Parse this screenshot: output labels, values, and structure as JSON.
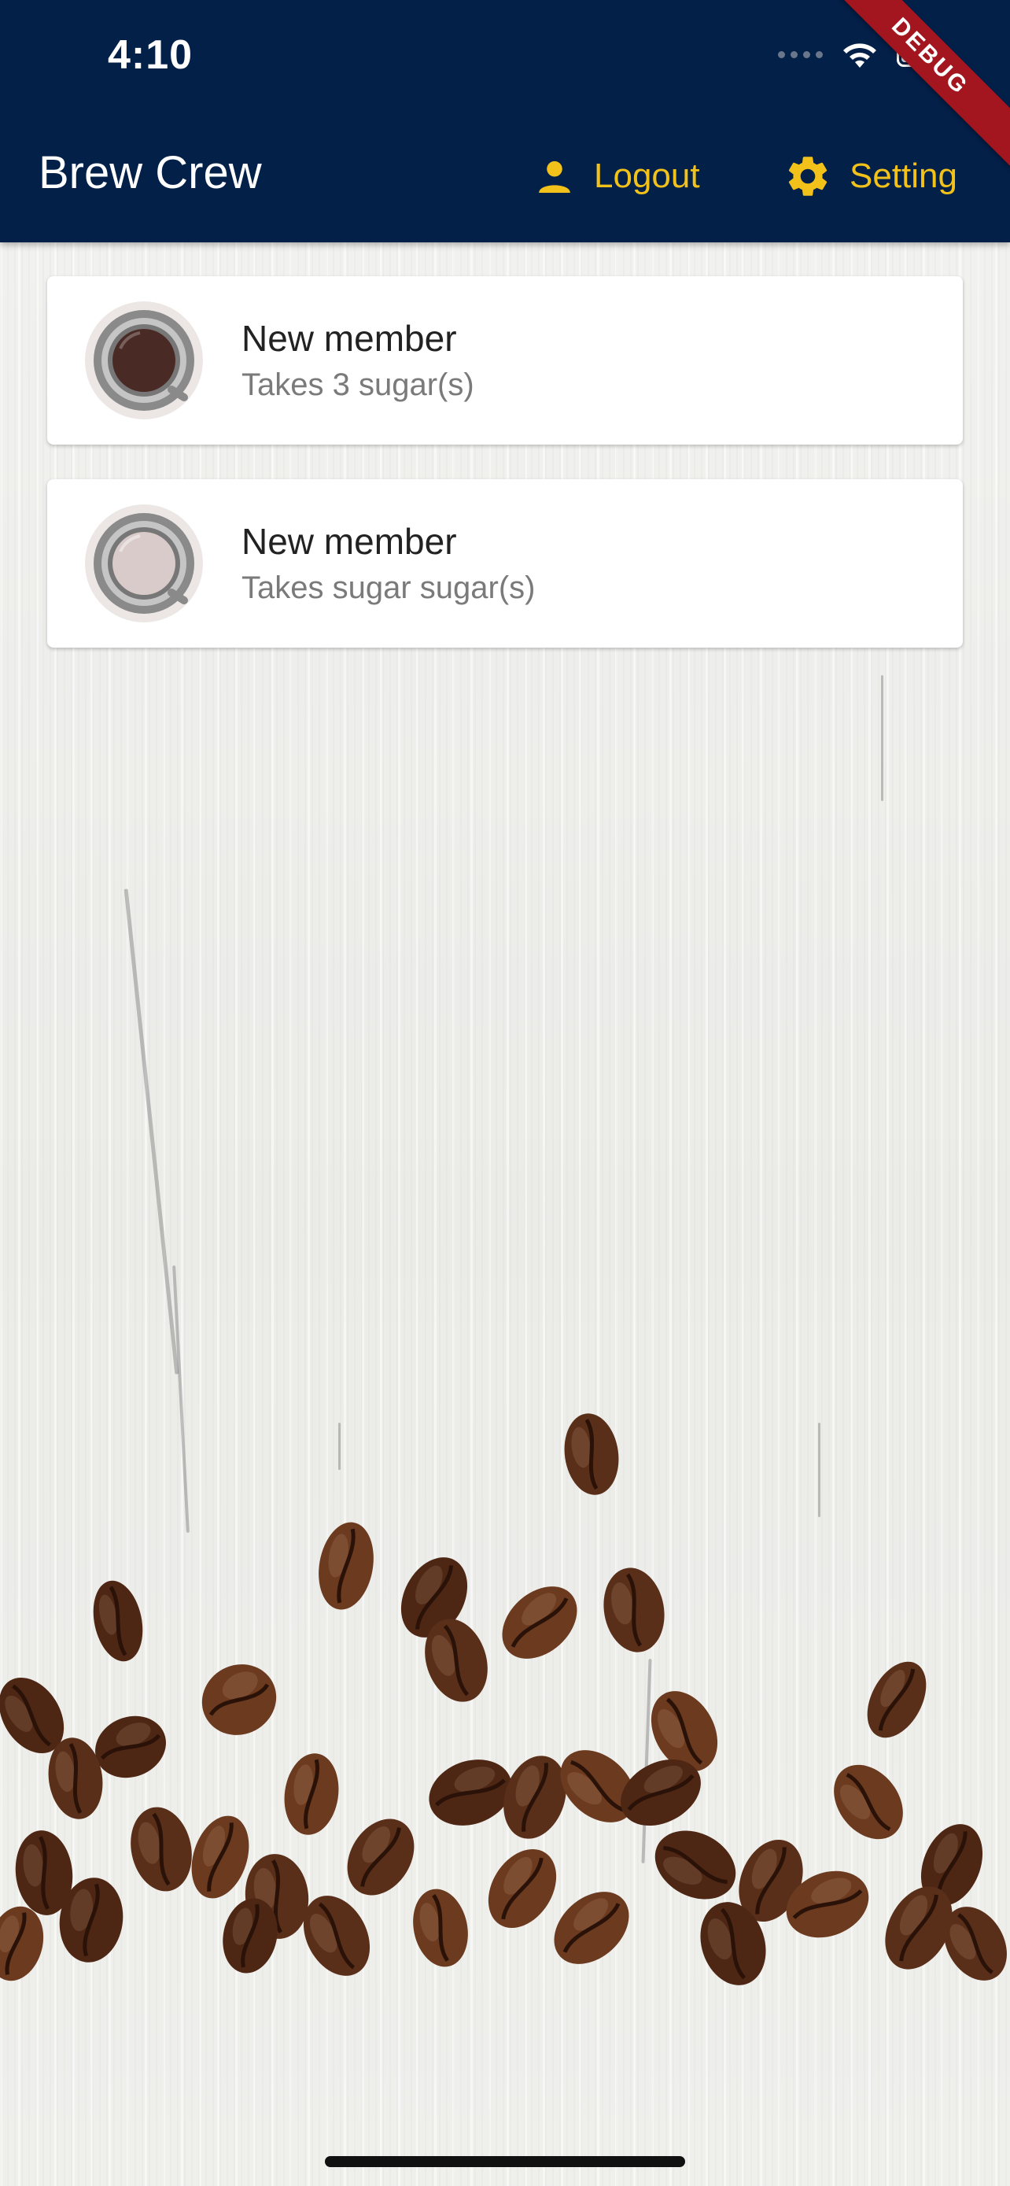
{
  "status_bar": {
    "time": "4:10"
  },
  "app_bar": {
    "title": "Brew Crew",
    "actions": [
      {
        "label": "Logout",
        "icon": "person-icon"
      },
      {
        "label": "Setting",
        "icon": "gear-icon"
      }
    ]
  },
  "debug_banner": "DEBUG",
  "members": [
    {
      "name": "New member",
      "sugars_text": "Takes 3 sugar(s)",
      "coffee_color": "#4a2a25"
    },
    {
      "name": "New member",
      "sugars_text": "Takes sugar sugar(s)",
      "coffee_color": "#d9cbc9"
    }
  ],
  "colors": {
    "app_bar": "#032049",
    "accent": "#f2c21a",
    "ribbon": "#a3161f"
  }
}
